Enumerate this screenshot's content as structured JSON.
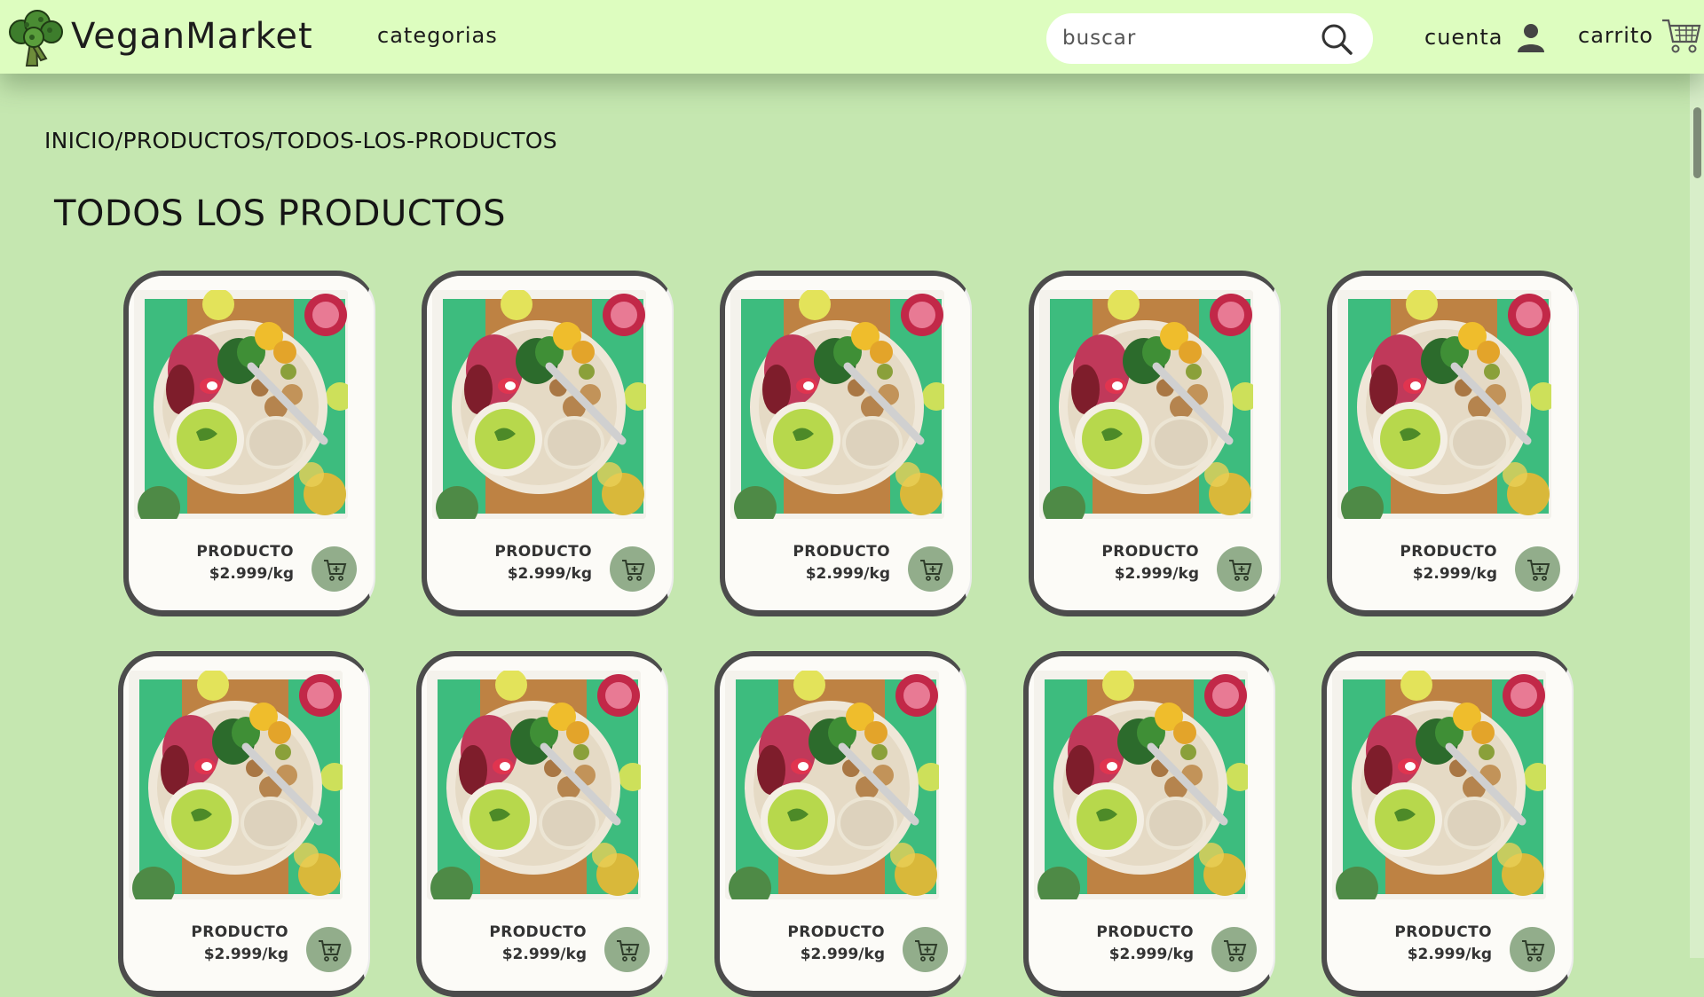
{
  "header": {
    "brand": "VeganMarket",
    "nav_categories": "categorias",
    "search": {
      "placeholder": "buscar",
      "value": ""
    },
    "account_label": "cuenta",
    "cart_label": "carrito"
  },
  "breadcrumb": {
    "items": [
      "INICIO",
      "PRODUCTOS",
      "TODOS-LOS-PRODUCTOS"
    ],
    "separator": "/"
  },
  "page_title": "TODOS LOS PRODUCTOS",
  "products": [
    {
      "name": "PRODUCTO",
      "price": "$2.999/kg"
    },
    {
      "name": "PRODUCTO",
      "price": "$2.999/kg"
    },
    {
      "name": "PRODUCTO",
      "price": "$2.999/kg"
    },
    {
      "name": "PRODUCTO",
      "price": "$2.999/kg"
    },
    {
      "name": "PRODUCTO",
      "price": "$2.999/kg"
    },
    {
      "name": "PRODUCTO",
      "price": "$2.999/kg"
    },
    {
      "name": "PRODUCTO",
      "price": "$2.999/kg"
    },
    {
      "name": "PRODUCTO",
      "price": "$2.999/kg"
    },
    {
      "name": "PRODUCTO",
      "price": "$2.999/kg"
    },
    {
      "name": "PRODUCTO",
      "price": "$2.999/kg"
    }
  ],
  "icons": {
    "logo": "broccoli-icon",
    "search": "search-icon",
    "account": "user-icon",
    "cart": "cart-icon",
    "add_to_cart": "add-to-cart-icon"
  },
  "colors": {
    "header_bg": "#ddfdbf",
    "page_bg": "#c5e7b0",
    "card_bg": "#fcfbf7",
    "button_green": "#92ad8b",
    "dark_text": "#333333"
  }
}
